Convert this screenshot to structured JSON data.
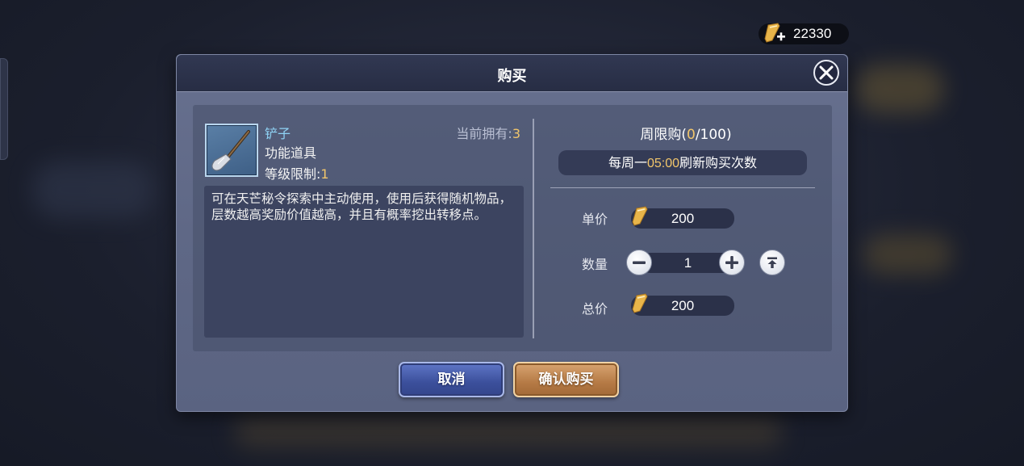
{
  "currency": {
    "amount": "22330",
    "icon": "gold-scroll-plus-icon"
  },
  "dialog": {
    "title": "购买",
    "close_icon": "close-icon"
  },
  "item": {
    "name": "铲子",
    "type": "功能道具",
    "level_label": "等级限制:",
    "level_value": "1",
    "owned_label": "当前拥有:",
    "owned_value": "3",
    "icon": "shovel-icon",
    "description": "可在天芒秘令探索中主动使用，使用后获得随机物品，层数越高奖励价值越高，并且有概率挖出转移点。"
  },
  "limit": {
    "label": "周限购",
    "open": "(",
    "bought": "0",
    "sep": "/",
    "max": "100",
    "close": ")",
    "refresh_prefix": "每周一",
    "refresh_time": "05:00",
    "refresh_suffix": "刷新购买次数"
  },
  "purchase": {
    "unit_price_label": "单价",
    "unit_price": "200",
    "quantity_label": "数量",
    "quantity": "1",
    "total_label": "总价",
    "total": "200",
    "price_icon": "gold-scroll-icon"
  },
  "buttons": {
    "cancel": "取消",
    "confirm": "确认购买"
  },
  "colors": {
    "accent_gold": "#f2c66b",
    "item_name": "#8fd3f5",
    "dialog_bg": "#616a88",
    "header_bg": "#2c334b"
  }
}
